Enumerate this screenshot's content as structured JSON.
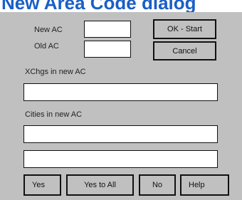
{
  "window": {
    "title": "New Area Code dialog"
  },
  "fields": {
    "new_ac": {
      "label": "New AC",
      "value": ""
    },
    "old_ac": {
      "label": "Old AC",
      "value": ""
    },
    "xchgs": {
      "label": "XChgs in new AC",
      "value": ""
    },
    "cities": {
      "label": "Cities in new AC",
      "value_1": "",
      "value_2": ""
    }
  },
  "buttons": {
    "ok_start": "OK - Start",
    "cancel": "Cancel",
    "yes": "Yes",
    "yes_to_all": "Yes to All",
    "no": "No",
    "help": "Help"
  },
  "colors": {
    "title": "#1a5fc6",
    "dialog_bg": "#c0c0c0"
  }
}
